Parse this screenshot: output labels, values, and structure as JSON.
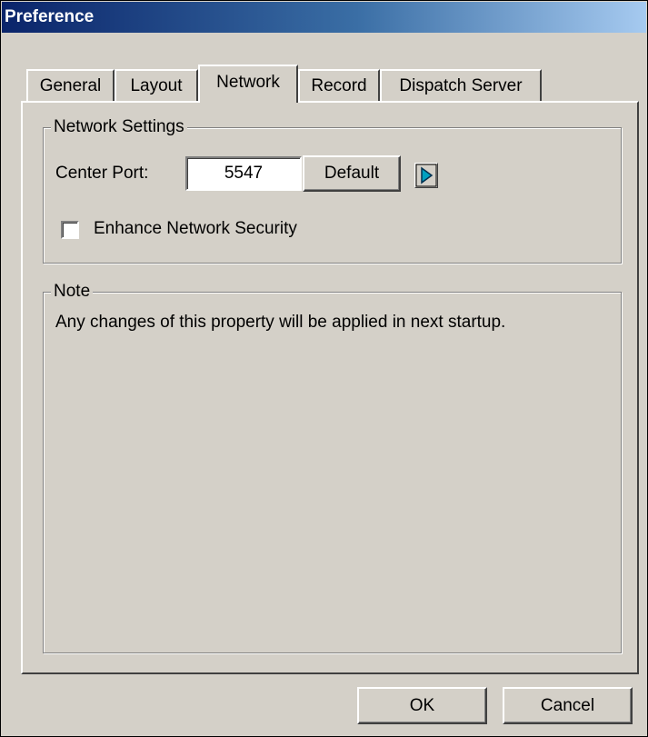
{
  "window": {
    "title": "Preference"
  },
  "tabs": [
    {
      "label": "General"
    },
    {
      "label": "Layout"
    },
    {
      "label": "Network",
      "active": true
    },
    {
      "label": "Record"
    },
    {
      "label": "Dispatch Server"
    }
  ],
  "network_settings": {
    "legend": "Network Settings",
    "center_port_label": "Center Port:",
    "center_port_value": "5547",
    "default_button": "Default",
    "arrow_icon": "play-arrow-icon",
    "enhance_security_label": "Enhance Network Security",
    "enhance_security_checked": false
  },
  "note": {
    "legend": "Note",
    "text": "Any changes of this property will be applied in next startup."
  },
  "footer": {
    "ok_label": "OK",
    "cancel_label": "Cancel"
  },
  "colors": {
    "face": "#d4d0c8",
    "title_start": "#0a246a",
    "title_end": "#a6caf0",
    "arrow_fill": "#00a0c0"
  }
}
